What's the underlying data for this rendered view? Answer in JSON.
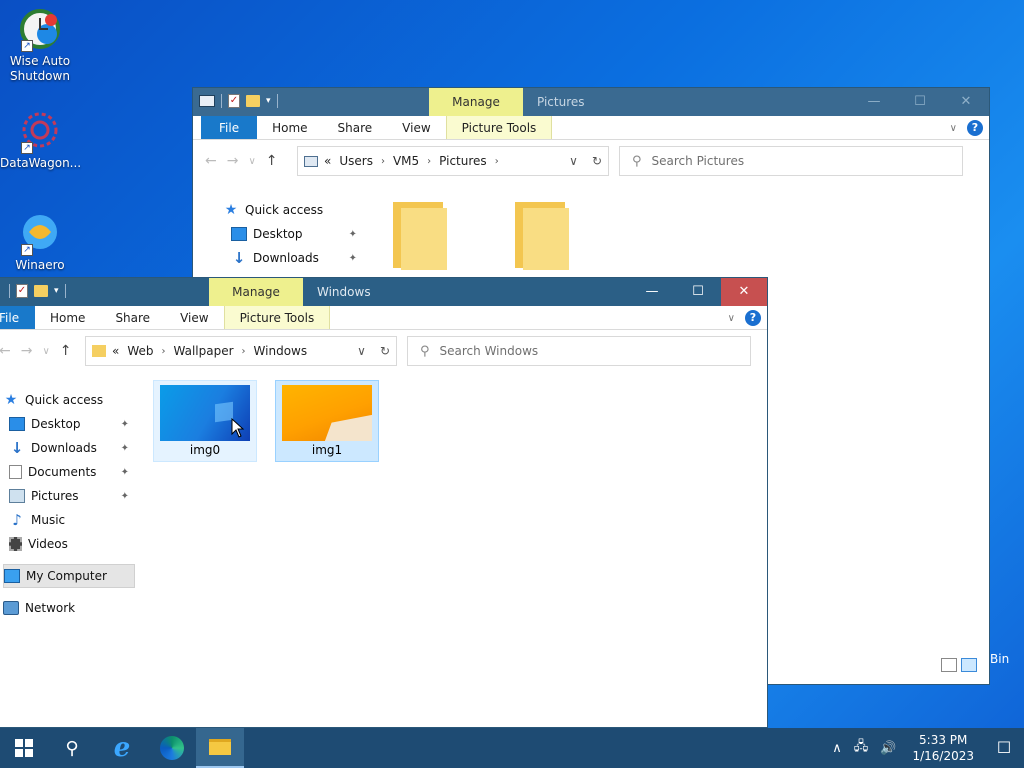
{
  "desktop": {
    "icons": [
      {
        "label_line1": "Wise Auto",
        "label_line2": "Shutdown"
      },
      {
        "label_line1": "DataWagon...",
        "label_line2": ""
      },
      {
        "label_line1": "Winaero",
        "label_line2": ""
      }
    ],
    "peek_text": "Bin"
  },
  "back_window": {
    "title": "Pictures",
    "context_tab": "Manage",
    "ribbon_tabs": {
      "file": "File",
      "home": "Home",
      "share": "Share",
      "view": "View",
      "tools": "Picture Tools"
    },
    "address": {
      "overflow": "«",
      "crumbs": [
        "Users",
        "VM5",
        "Pictures"
      ]
    },
    "search_placeholder": "Search Pictures",
    "nav": {
      "quick_access": "Quick access",
      "desktop": "Desktop",
      "downloads": "Downloads"
    }
  },
  "front_window": {
    "title": "Windows",
    "context_tab": "Manage",
    "ribbon_tabs": {
      "file": "File",
      "home": "Home",
      "share": "Share",
      "view": "View",
      "tools": "Picture Tools"
    },
    "address": {
      "overflow": "«",
      "crumbs": [
        "Web",
        "Wallpaper",
        "Windows"
      ]
    },
    "search_placeholder": "Search Windows",
    "nav": {
      "quick_access": "Quick access",
      "desktop": "Desktop",
      "downloads": "Downloads",
      "documents": "Documents",
      "pictures": "Pictures",
      "music": "Music",
      "videos": "Videos",
      "my_computer": "My Computer",
      "network": "Network"
    },
    "files": [
      {
        "name": "img0",
        "state": "hover"
      },
      {
        "name": "img1",
        "state": "selected"
      }
    ]
  },
  "glyphs": {
    "minimize": "—",
    "maximize": "☐",
    "close": "✕",
    "help": "?",
    "chevron": "∨",
    "back": "←",
    "forward": "→",
    "recent": "∨",
    "up": "↑",
    "refresh": "↻",
    "search": "⚲",
    "pin": "✦",
    "star": "★",
    "download": "↓",
    "music": "♪",
    "check": "✓",
    "drop": "▾",
    "sep": "›"
  },
  "taskbar": {
    "time": "5:33 PM",
    "date": "1/16/2023",
    "ie_glyph": "e",
    "search_glyph": "⚲",
    "tray_up": "∧",
    "tray_net": "🖧",
    "tray_vol": "🔊",
    "notif_glyph": "☐"
  },
  "colors": {
    "titlebar": "#2b5f86",
    "file_tab": "#1979ca",
    "context_tab": "#eef08e",
    "close_hover": "#c75050",
    "selection": "#cce8ff",
    "taskbar": "#1e4b73"
  }
}
